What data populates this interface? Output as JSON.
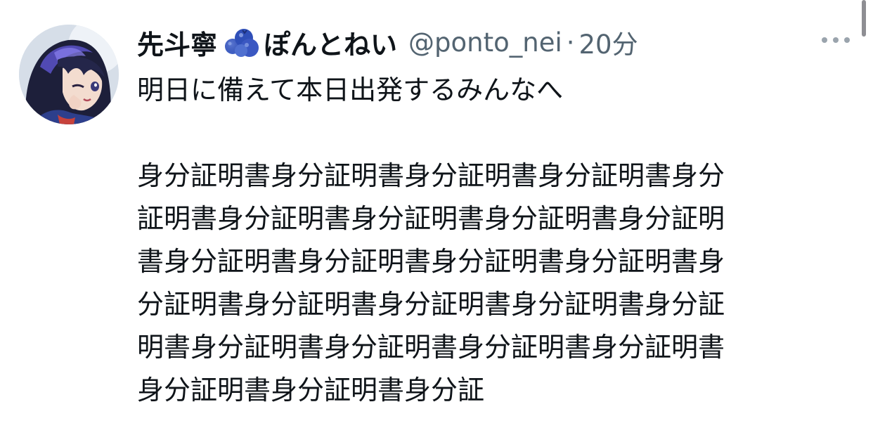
{
  "tweet": {
    "display_name": "先斗寧",
    "display_name_suffix": "ぽんとねい",
    "name_emoji": "blueberries-emoji",
    "handle": "@ponto_nei",
    "separator": "·",
    "time": "20分",
    "text_line_1": "明日に備えて本日出発するみんなへ",
    "body_lines": [
      "身分証明書身分証明書身分証明書身分証明書身分",
      "証明書身分証明書身分証明書身分証明書身分証明",
      "書身分証明書身分証明書身分証明書身分証明書身",
      "分証明書身分証明書身分証明書身分証明書身分証",
      "明書身分証明書身分証明書身分証明書身分証明書",
      "身分証明書身分証明書身分証"
    ]
  },
  "colors": {
    "text": "#0f1419",
    "secondary": "#536471",
    "background": "#ffffff"
  },
  "icons": {
    "more": "more-dots-icon",
    "avatar": "anime-avatar"
  }
}
